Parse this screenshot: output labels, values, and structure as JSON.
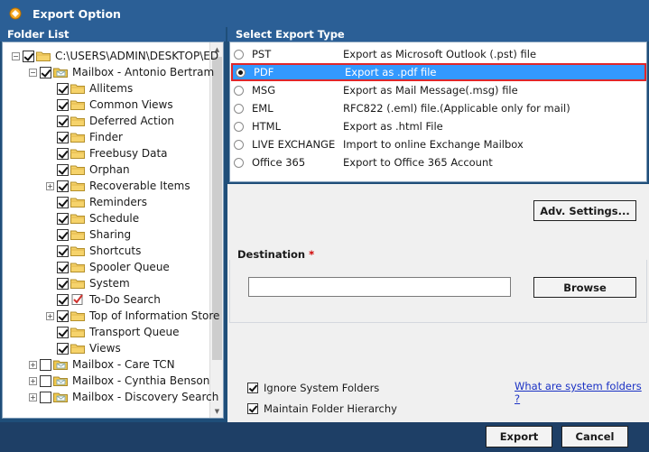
{
  "window": {
    "title": "Export Option",
    "icon": "app-icon"
  },
  "folder_list": {
    "header": "Folder List",
    "items": [
      {
        "label": "C:\\USERS\\ADMIN\\DESKTOP\\ED",
        "level": 0,
        "expander": "−",
        "checked": true,
        "icon": "folder-open-icon"
      },
      {
        "label": "Mailbox - Antonio Bertram",
        "level": 1,
        "expander": "−",
        "checked": true,
        "icon": "mailbox-icon"
      },
      {
        "label": "Allitems",
        "level": 2,
        "expander": "",
        "checked": true,
        "icon": "folder-icon"
      },
      {
        "label": "Common Views",
        "level": 2,
        "expander": "",
        "checked": true,
        "icon": "folder-icon"
      },
      {
        "label": "Deferred Action",
        "level": 2,
        "expander": "",
        "checked": true,
        "icon": "folder-icon"
      },
      {
        "label": "Finder",
        "level": 2,
        "expander": "",
        "checked": true,
        "icon": "folder-icon"
      },
      {
        "label": "Freebusy Data",
        "level": 2,
        "expander": "",
        "checked": true,
        "icon": "folder-icon"
      },
      {
        "label": "Orphan",
        "level": 2,
        "expander": "",
        "checked": true,
        "icon": "folder-icon"
      },
      {
        "label": "Recoverable Items",
        "level": 2,
        "expander": "+",
        "checked": true,
        "icon": "folder-icon"
      },
      {
        "label": "Reminders",
        "level": 2,
        "expander": "",
        "checked": true,
        "icon": "folder-icon"
      },
      {
        "label": "Schedule",
        "level": 2,
        "expander": "",
        "checked": true,
        "icon": "folder-icon"
      },
      {
        "label": "Sharing",
        "level": 2,
        "expander": "",
        "checked": true,
        "icon": "folder-icon"
      },
      {
        "label": "Shortcuts",
        "level": 2,
        "expander": "",
        "checked": true,
        "icon": "folder-icon"
      },
      {
        "label": "Spooler Queue",
        "level": 2,
        "expander": "",
        "checked": true,
        "icon": "folder-icon"
      },
      {
        "label": "System",
        "level": 2,
        "expander": "",
        "checked": true,
        "icon": "folder-icon"
      },
      {
        "label": "To-Do Search",
        "level": 2,
        "expander": "",
        "checked": true,
        "icon": "todo-icon"
      },
      {
        "label": "Top of Information Store",
        "level": 2,
        "expander": "+",
        "checked": true,
        "icon": "folder-icon"
      },
      {
        "label": "Transport Queue",
        "level": 2,
        "expander": "",
        "checked": true,
        "icon": "folder-icon"
      },
      {
        "label": "Views",
        "level": 2,
        "expander": "",
        "checked": true,
        "icon": "folder-icon"
      },
      {
        "label": "Mailbox - Care TCN",
        "level": 1,
        "expander": "+",
        "checked": false,
        "icon": "mailbox-icon"
      },
      {
        "label": "Mailbox - Cynthia Benson",
        "level": 1,
        "expander": "+",
        "checked": false,
        "icon": "mailbox-icon"
      },
      {
        "label": "Mailbox - Discovery Search M",
        "level": 1,
        "expander": "+",
        "checked": false,
        "icon": "mailbox-icon"
      }
    ]
  },
  "export_type": {
    "header": "Select Export Type",
    "options": [
      {
        "name": "PST",
        "desc": "Export as Microsoft Outlook (.pst) file",
        "selected": false
      },
      {
        "name": "PDF",
        "desc": "Export as .pdf file",
        "selected": true
      },
      {
        "name": "MSG",
        "desc": "Export as Mail Message(.msg) file",
        "selected": false
      },
      {
        "name": "EML",
        "desc": "RFC822 (.eml) file.(Applicable only for mail)",
        "selected": false
      },
      {
        "name": "HTML",
        "desc": "Export as .html File",
        "selected": false
      },
      {
        "name": "LIVE EXCHANGE",
        "desc": "Import to online Exchange Mailbox",
        "selected": false
      },
      {
        "name": "Office 365",
        "desc": "Export to Office 365 Account",
        "selected": false
      }
    ]
  },
  "adv_settings_label": "Adv. Settings...",
  "destination": {
    "label": "Destination",
    "required_mark": "*",
    "value": "",
    "browse_label": "Browse"
  },
  "options": {
    "ignore_system_folders": {
      "label": "Ignore System Folders",
      "checked": true
    },
    "maintain_hierarchy": {
      "label": "Maintain Folder Hierarchy",
      "checked": true
    },
    "system_folders_link": "What are system folders ?"
  },
  "footer": {
    "export_label": "Export",
    "cancel_label": "Cancel"
  },
  "colors": {
    "header_blue": "#2b5f96",
    "footer_navy": "#1e3f66",
    "selection_blue": "#3399ff",
    "selection_border": "#e0262a",
    "link": "#1a31c4",
    "required": "#d00000"
  }
}
